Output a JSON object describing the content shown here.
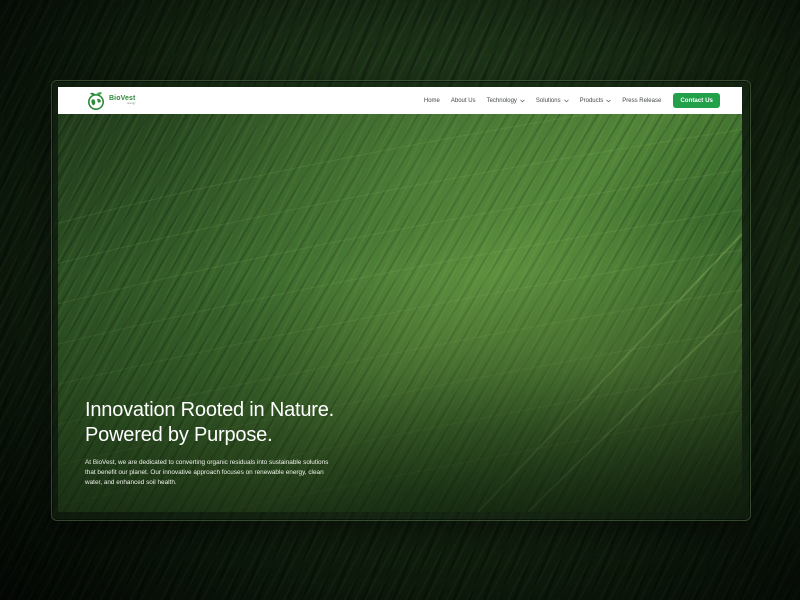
{
  "brand": {
    "name": "BioVest",
    "tagline": "Energy",
    "primary_color": "#2f8a3a",
    "accent_color": "#23a04a"
  },
  "nav": {
    "items": [
      {
        "label": "Home",
        "has_dropdown": false
      },
      {
        "label": "About Us",
        "has_dropdown": false
      },
      {
        "label": "Technology",
        "has_dropdown": true
      },
      {
        "label": "Solutions",
        "has_dropdown": true
      },
      {
        "label": "Products",
        "has_dropdown": true
      },
      {
        "label": "Press Release",
        "has_dropdown": false
      }
    ],
    "cta_label": "Contact Us"
  },
  "hero": {
    "title_line1": "Innovation Rooted in Nature.",
    "title_line2": "Powered by Purpose.",
    "description": "At BioVest, we are dedicated to converting organic residuals into sustainable solutions that benefit our planet. Our innovative approach focuses on renewable energy, clean water, and enhanced soil health."
  },
  "icons": {
    "logo": "globe-leaf-icon",
    "dropdown": "chevron-down-icon"
  }
}
